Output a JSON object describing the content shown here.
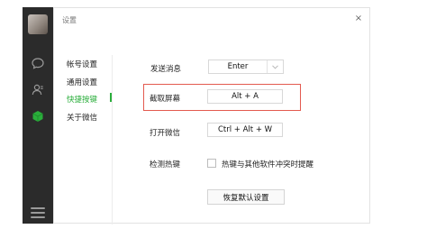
{
  "window": {
    "title": "设置",
    "close_glyph": "×"
  },
  "nav": {
    "items": [
      {
        "label": "帐号设置"
      },
      {
        "label": "通用设置"
      },
      {
        "label": "快捷按键"
      },
      {
        "label": "关于微信"
      }
    ],
    "active_index": 2
  },
  "shortcuts": {
    "send_message": {
      "label": "发送消息",
      "value": "Enter"
    },
    "screenshot": {
      "label": "截取屏幕",
      "value": "Alt + A"
    },
    "open_wechat": {
      "label": "打开微信",
      "value": "Ctrl + Alt + W"
    },
    "detect_hotkey": {
      "label": "检测热键",
      "checkbox_label": "热键与其他软件冲突时提醒",
      "checked": false
    },
    "restore_button": "恢复默认设置"
  },
  "colors": {
    "accent": "#2aae3b",
    "highlight": "#e35a4f",
    "rail": "#2b2b2b"
  },
  "icons": [
    "chat-icon",
    "contacts-icon",
    "favorites-icon",
    "menu-icon"
  ]
}
